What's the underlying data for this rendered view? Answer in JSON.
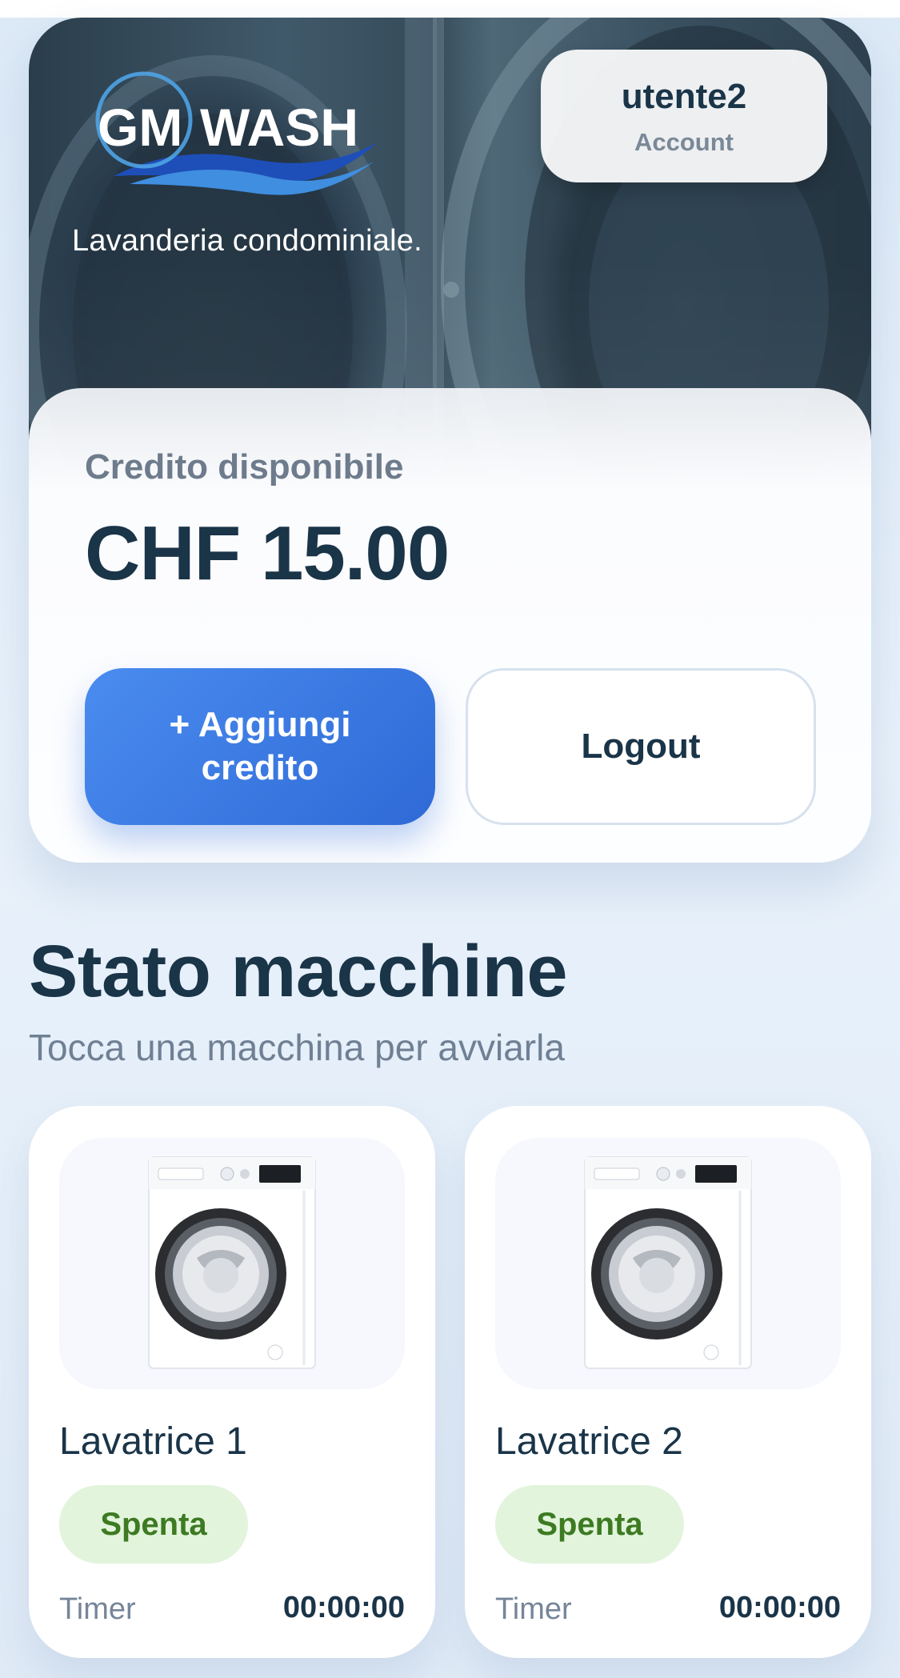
{
  "brand": {
    "logo_text_gm": "GM",
    "logo_text_wash": "WASH",
    "tagline": "Lavanderia condominiale."
  },
  "account": {
    "username": "utente2",
    "label": "Account"
  },
  "credit": {
    "label": "Credito disponibile",
    "amount": "CHF 15.00",
    "add_button": "+ Aggiungi credito",
    "logout_button": "Logout"
  },
  "machines_section": {
    "title": "Stato macchine",
    "subtitle": "Tocca una macchina per avviarla"
  },
  "machines": [
    {
      "name": "Lavatrice 1",
      "status": "Spenta",
      "timer_label": "Timer",
      "timer": "00:00:00"
    },
    {
      "name": "Lavatrice 2",
      "status": "Spenta",
      "timer_label": "Timer",
      "timer": "00:00:00"
    }
  ],
  "colors": {
    "primary": "#2f6ad6",
    "text_dark": "#1a3448",
    "status_off_bg": "#e2f4dc",
    "status_off_text": "#3d7a22"
  }
}
